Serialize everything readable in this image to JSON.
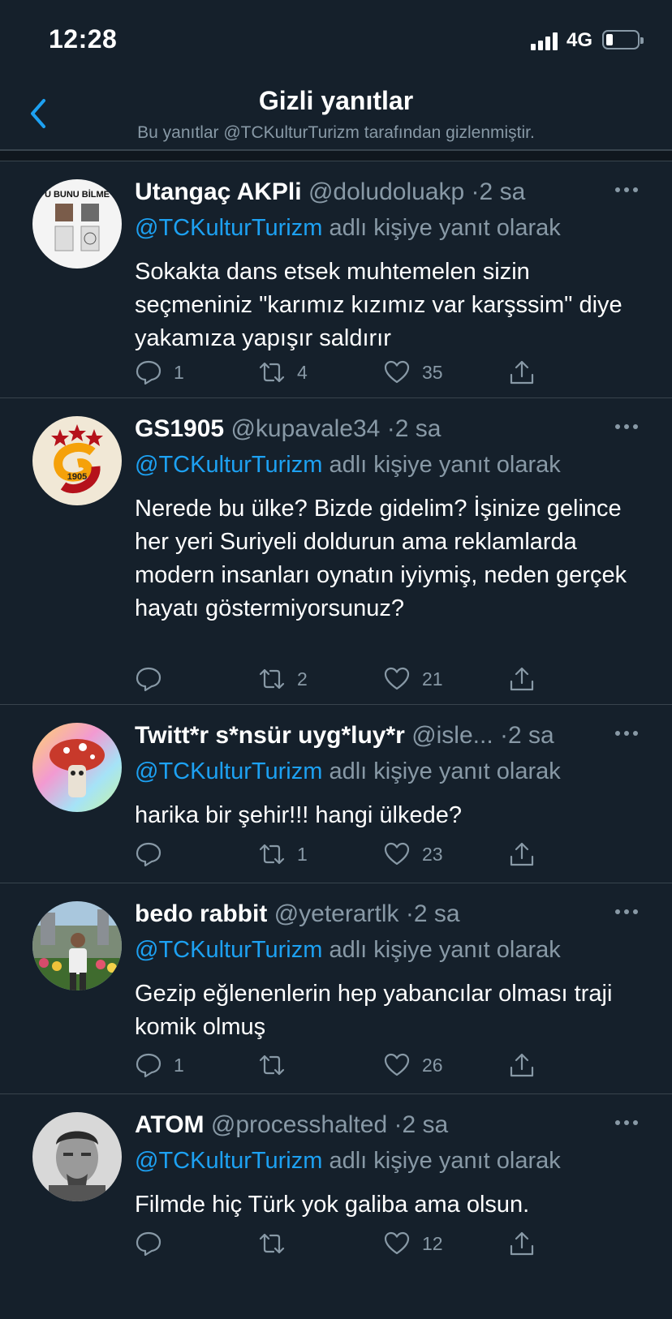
{
  "status_bar": {
    "time": "12:28",
    "network": "4G"
  },
  "header": {
    "title": "Gizli yanıtlar",
    "subtitle": "Bu yanıtlar @TCKulturTurizm tarafından gizlenmiştir."
  },
  "reply_suffix": " adlı kişiye yanıt olarak",
  "tweets": [
    {
      "name": "Utangaç AKPli",
      "handle": "@doludoluakp",
      "time": "2 sa",
      "reply_to": "@TCKulturTurizm",
      "text": "Sokakta dans etsek muhtemelen sizin seçmeniniz \"karımız kızımız var karşssim\" diye yakamıza yapışır saldırır",
      "replies": "1",
      "retweets": "4",
      "likes": "35",
      "avatar_text": "U BUNU BİLME"
    },
    {
      "name": "GS1905",
      "handle": "@kupavale34",
      "time": "2 sa",
      "reply_to": "@TCKulturTurizm",
      "text": "Nerede bu ülke? Bizde gidelim? İşinize gelince her yeri Suriyeli doldurun ama reklamlarda modern insanları oynatın iyiymiş, neden gerçek hayatı göstermiyorsunuz?",
      "replies": "",
      "retweets": "2",
      "likes": "21",
      "avatar_text": "1905"
    },
    {
      "name": "Twitt*r s*nsür uyg*luy*r",
      "handle": "@isle...",
      "time": "2 sa",
      "reply_to": "@TCKulturTurizm",
      "text": "harika bir şehir!!! hangi ülkede?",
      "replies": "",
      "retweets": "1",
      "likes": "23",
      "avatar_text": ""
    },
    {
      "name": "bedo rabbit",
      "handle": "@yeterartlk",
      "time": "2 sa",
      "reply_to": "@TCKulturTurizm",
      "text": "Gezip eğlenenlerin hep yabancılar olması traji komik olmuş",
      "replies": "1",
      "retweets": "",
      "likes": "26",
      "avatar_text": ""
    },
    {
      "name": "ATOM",
      "handle": "@processhalted",
      "time": "2 sa",
      "reply_to": "@TCKulturTurizm",
      "text": "Filmde hiç Türk yok galiba ama olsun.",
      "replies": "",
      "retweets": "",
      "likes": "12",
      "avatar_text": ""
    }
  ],
  "colors": {
    "background": "#15202b",
    "accent": "#1da1f2",
    "muted": "#8899a6",
    "divider": "#38444d"
  },
  "icons": [
    "reply-icon",
    "retweet-icon",
    "like-icon",
    "share-icon",
    "more-icon",
    "back-chevron-icon"
  ]
}
